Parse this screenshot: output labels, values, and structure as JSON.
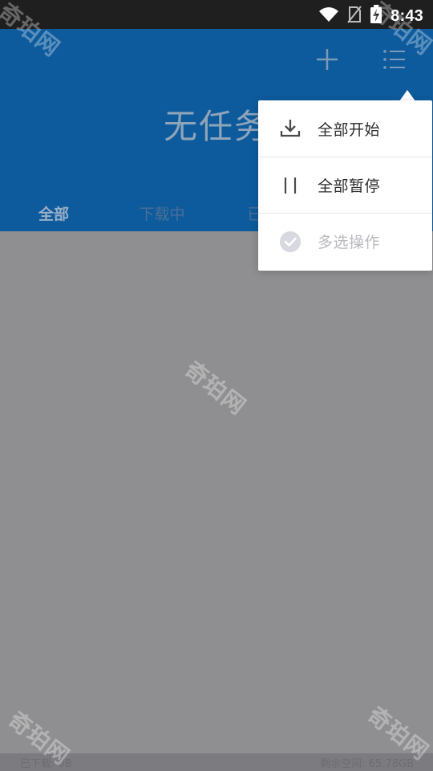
{
  "status_bar": {
    "time": "8:43",
    "icons": [
      "wifi-icon",
      "no-sim-icon",
      "battery-charging-icon"
    ]
  },
  "app_bar": {
    "title": "无任务",
    "actions": [
      {
        "name": "add-button",
        "icon": "plus-icon"
      },
      {
        "name": "menu-button",
        "icon": "list-menu-icon"
      }
    ]
  },
  "tabs": [
    {
      "label": "全部",
      "active": true
    },
    {
      "label": "下载中",
      "active": false
    },
    {
      "label": "已",
      "active": false
    }
  ],
  "popup_menu": {
    "items": [
      {
        "label": "全部开始",
        "icon": "download-icon",
        "enabled": true
      },
      {
        "label": "全部暂停",
        "icon": "pause-icon",
        "enabled": true
      },
      {
        "label": "多选操作",
        "icon": "check-circle-icon",
        "enabled": false
      }
    ]
  },
  "footer": {
    "downloaded": "已下载: 0B",
    "free_space": "剩余空间: 65.78GB"
  },
  "watermark": {
    "text": "奇珀网"
  },
  "colors": {
    "primary": "#0D5B9D",
    "overlay": "#8F8F91",
    "menu_bg": "#FFFFFF",
    "menu_text": "#2B2B2B",
    "disabled_text": "#B9B9C0"
  }
}
